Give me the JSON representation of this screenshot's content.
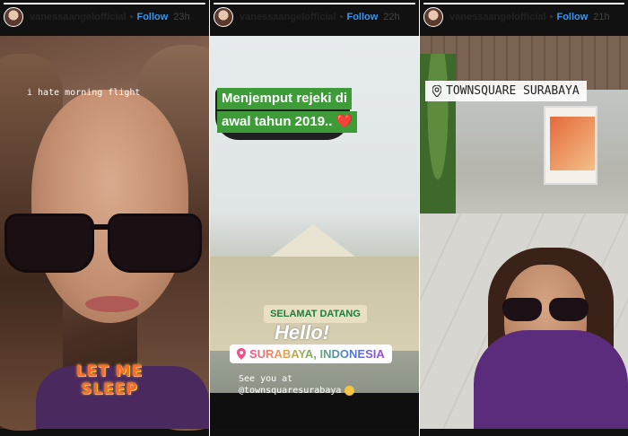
{
  "stories": [
    {
      "username": "vanessaangelofficial",
      "follow_label": "Follow",
      "time": "23h",
      "progress": 1.0,
      "caption": "i hate morning flight",
      "sticker": "LET ME SLEEP"
    },
    {
      "username": "vanessaangelofficial",
      "follow_label": "Follow",
      "time": "22h",
      "progress": 1.0,
      "banner_line1": "Menjemput rejeki di",
      "banner_line2": "awal tahun 2019..",
      "banner_emoji": "❤️",
      "gate_sign": "SELAMAT DATANG",
      "hello": "Hello!",
      "location": "SURABAYA, INDONESIA",
      "see_you_line1": "See you at",
      "see_you_line2": "@townsquaresurabaya"
    },
    {
      "username": "vanessaangelofficial",
      "follow_label": "Follow",
      "time": "21h",
      "progress": 1.0,
      "location": "TOWNSQUARE SURABAYA"
    }
  ],
  "colors": {
    "follow": "#3897f0",
    "banner_green": "#3d9b38",
    "sleep_text": "#ff6a2a"
  },
  "icons": {
    "location": "pin-icon",
    "avatar": "avatar"
  }
}
